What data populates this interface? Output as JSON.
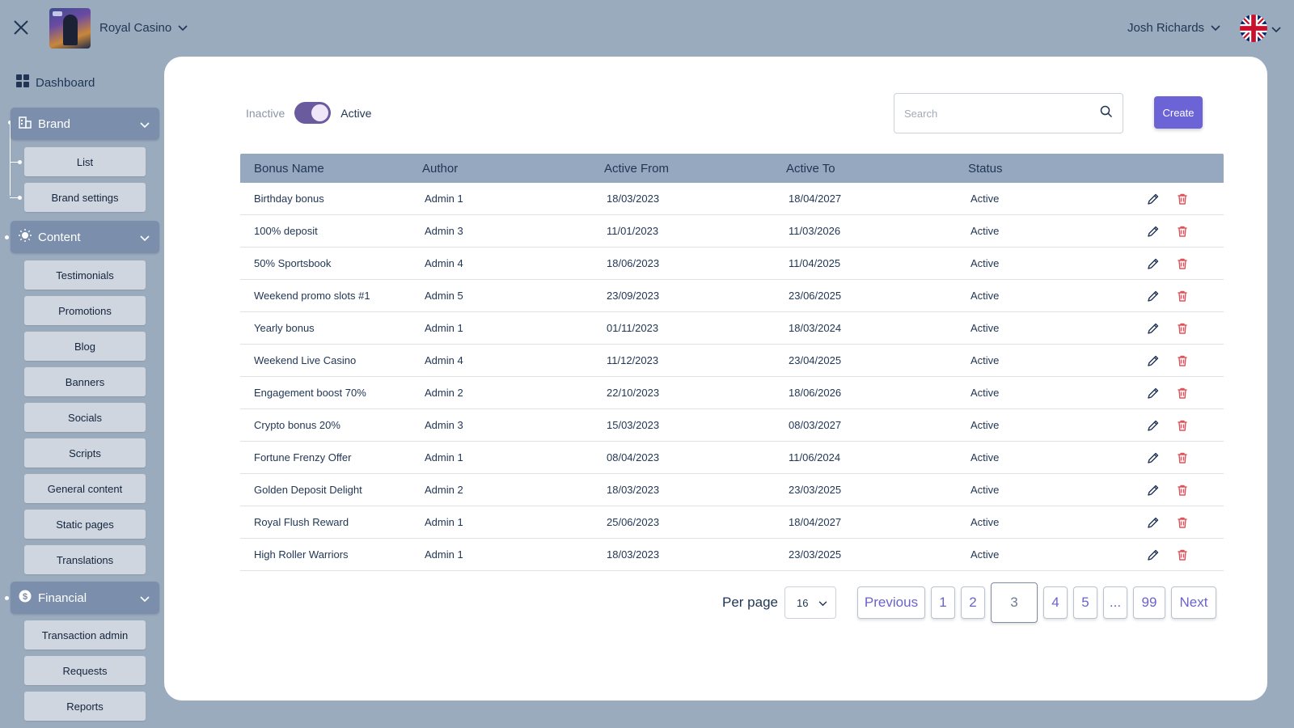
{
  "topbar": {
    "brand_name": "Royal Casino",
    "user_name": "Josh Richards"
  },
  "sidebar": {
    "dashboard": "Dashboard",
    "brand": {
      "label": "Brand",
      "items": [
        "List",
        "Brand settings"
      ]
    },
    "content": {
      "label": "Content",
      "items": [
        "Testimonials",
        "Promotions",
        "Blog",
        "Banners",
        "Socials",
        "Scripts",
        "General content",
        "Static pages",
        "Translations"
      ]
    },
    "financial": {
      "label": "Financial",
      "items": [
        "Transaction admin",
        "Requests",
        "Reports"
      ]
    }
  },
  "filters": {
    "inactive_label": "Inactive",
    "active_label": "Active",
    "toggle_on": true,
    "search_placeholder": "Search",
    "create_label": "Create"
  },
  "table": {
    "headers": [
      "Bonus Name",
      "Author",
      "Active From",
      "Active To",
      "Status"
    ],
    "rows": [
      [
        "Birthday bonus",
        "Admin 1",
        "18/03/2023",
        "18/04/2027",
        "Active"
      ],
      [
        "100% deposit",
        "Admin 3",
        "11/01/2023",
        "11/03/2026",
        "Active"
      ],
      [
        "50% Sportsbook",
        "Admin 4",
        "18/06/2023",
        "11/04/2025",
        "Active"
      ],
      [
        "Weekend promo slots #1",
        "Admin 5",
        "23/09/2023",
        "23/06/2025",
        "Active"
      ],
      [
        "Yearly bonus",
        "Admin 1",
        "01/11/2023",
        "18/03/2024",
        "Active"
      ],
      [
        "Weekend Live Casino",
        "Admin 4",
        "11/12/2023",
        "23/04/2025",
        "Active"
      ],
      [
        "Engagement boost 70%",
        "Admin 2",
        "22/10/2023",
        "18/06/2026",
        "Active"
      ],
      [
        "Crypto bonus 20%",
        "Admin 3",
        "15/03/2023",
        "08/03/2027",
        "Active"
      ],
      [
        "Fortune Frenzy Offer",
        "Admin 1",
        "08/04/2023",
        "11/06/2024",
        "Active"
      ],
      [
        "Golden Deposit Delight",
        "Admin 2",
        "18/03/2023",
        "23/03/2025",
        "Active"
      ],
      [
        "Royal Flush Reward",
        "Admin 1",
        "25/06/2023",
        "18/04/2027",
        "Active"
      ],
      [
        "High Roller Warriors",
        "Admin 1",
        "18/03/2023",
        "23/03/2025",
        "Active"
      ]
    ]
  },
  "pagination": {
    "per_page_label": "Per page",
    "per_page_value": "16",
    "previous": "Previous",
    "next": "Next",
    "pages": [
      "1",
      "2",
      "3",
      "4",
      "5",
      "...",
      "99"
    ],
    "current": "3"
  },
  "colors": {
    "background": "#9aabbe",
    "accent": "#6b63d6",
    "toggle": "#6a5a9e",
    "delete": "#e0525a"
  }
}
